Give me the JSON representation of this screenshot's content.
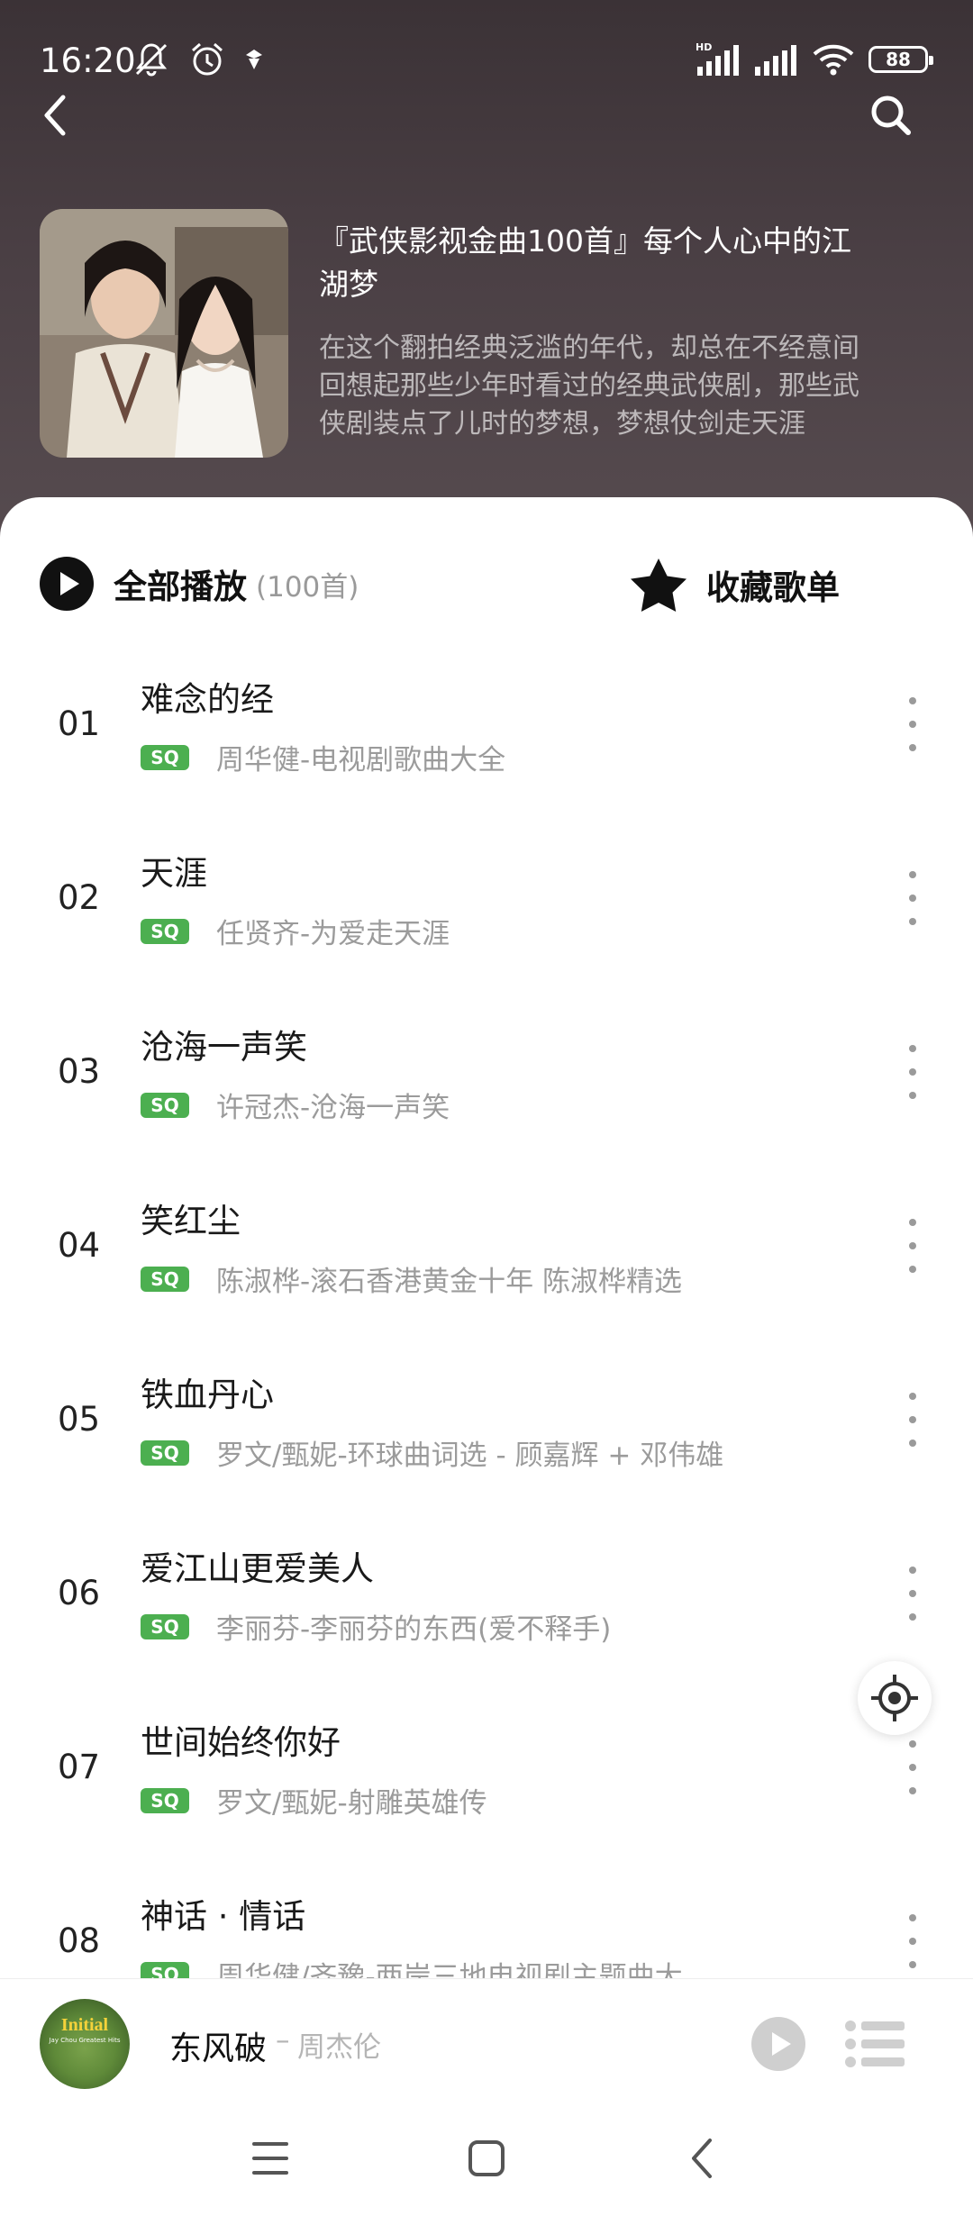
{
  "status_bar": {
    "time": "16:20",
    "battery": "88",
    "icons": [
      "mute-icon",
      "alarm-icon",
      "notification-icon",
      "hd-signal-icon",
      "signal-icon",
      "wifi-icon",
      "battery-icon"
    ]
  },
  "header": {
    "back_icon": "chevron-left-icon",
    "search_icon": "search-icon",
    "playlist_title": "『武侠影视金曲100首』每个人心中的江湖梦",
    "playlist_desc": "在这个翻拍经典泛滥的年代，却总在不经意间回想起那些少年时看过的经典武侠剧，那些武侠剧装点了儿时的梦想，梦想仗剑走天涯"
  },
  "actions": {
    "play_all_label": "全部播放",
    "play_all_count": "(100首)",
    "favorite_label": "收藏歌单"
  },
  "songs": [
    {
      "num": "01",
      "title": "难念的经",
      "badge": "SQ",
      "subtitle": "周华健-电视剧歌曲大全"
    },
    {
      "num": "02",
      "title": "天涯",
      "badge": "SQ",
      "subtitle": "任贤齐-为爱走天涯"
    },
    {
      "num": "03",
      "title": "沧海一声笑",
      "badge": "SQ",
      "subtitle": "许冠杰-沧海一声笑"
    },
    {
      "num": "04",
      "title": "笑红尘",
      "badge": "SQ",
      "subtitle": "陈淑桦-滚石香港黄金十年 陈淑桦精选"
    },
    {
      "num": "05",
      "title": "铁血丹心",
      "badge": "SQ",
      "subtitle": "罗文/甄妮-环球曲词选 - 顾嘉辉 + 邓伟雄"
    },
    {
      "num": "06",
      "title": "爱江山更爱美人",
      "badge": "SQ",
      "subtitle": "李丽芬-李丽芬的东西(爱不释手)"
    },
    {
      "num": "07",
      "title": "世间始终你好",
      "badge": "SQ",
      "subtitle": "罗文/甄妮-射雕英雄传"
    },
    {
      "num": "08",
      "title": "神话 · 情话",
      "badge": "SQ",
      "subtitle": "周华健/齐豫-两岸三地电视剧主题曲大"
    }
  ],
  "mini_player": {
    "cover_text": "Initial",
    "cover_sub": "Jay Chou Greatest Hits",
    "song": "东风破",
    "separator": "–",
    "artist": "周杰伦"
  },
  "nav": {
    "icons": [
      "menu-icon",
      "home-icon",
      "back-icon"
    ]
  },
  "colors": {
    "header_bg": "#4a3f44",
    "sq_badge": "#4caf50",
    "accent": "#111111"
  }
}
